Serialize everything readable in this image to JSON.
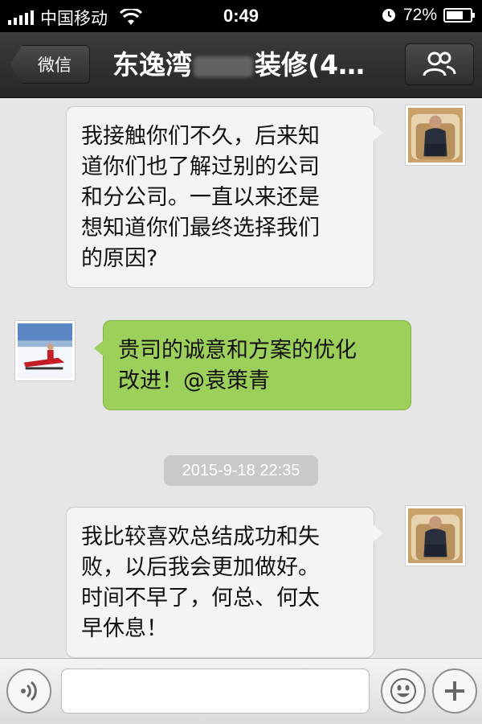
{
  "status_bar": {
    "carrier": "中国移动",
    "time": "0:49",
    "battery_percent": "72%",
    "battery_level": 0.72
  },
  "nav": {
    "back_label": "微信",
    "title_prefix": "东逸湾",
    "title_suffix": "装修(4…",
    "members_icon": "group-icon"
  },
  "messages": [
    {
      "direction": "incoming",
      "sender_avatar": "man-in-armchair",
      "lines": [
        "我接触你们不久，后来知",
        "道你们也了解过别的公司",
        "和分公司。一直以来还是",
        "想知道你们最终选择我们",
        "的原因?"
      ]
    },
    {
      "direction": "outgoing",
      "sender_avatar": "snowmobile-photo",
      "lines": [
        "贵司的诚意和方案的优化",
        "改进！@袁策青"
      ]
    },
    {
      "direction": "incoming",
      "sender_avatar": "man-in-armchair",
      "lines": [
        "我比较喜欢总结成功和失",
        "败，以后我会更加做好。",
        "时间不早了，何总、何太",
        "早休息！"
      ]
    }
  ],
  "timestamp": "2015-9-18 22:35",
  "input_bar": {
    "voice_icon": "voice-icon",
    "emoji_icon": "emoji-icon",
    "plus_icon": "plus-icon",
    "placeholder": ""
  },
  "colors": {
    "outgoing_bubble": "#9dd05a",
    "incoming_bubble": "#f4f4f4",
    "navbar": "#2e2e2e"
  }
}
